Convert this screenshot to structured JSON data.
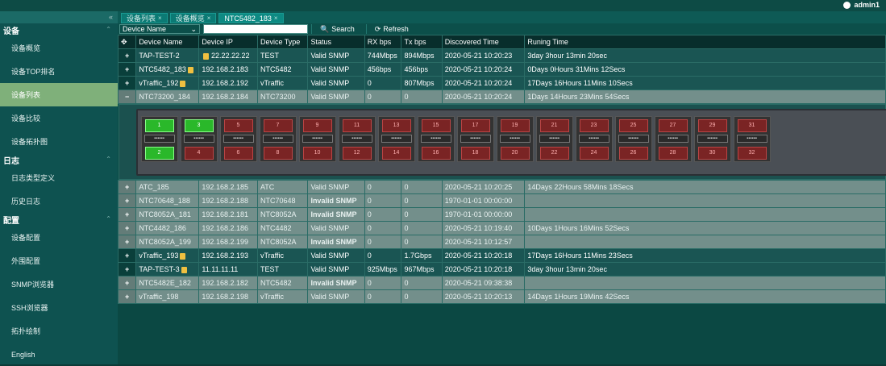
{
  "top": {
    "user": "admin1"
  },
  "sidebar": {
    "sections": [
      {
        "title": "设备",
        "items": [
          "设备概览",
          "设备TOP排名",
          "设备列表",
          "设备比较",
          "设备拓扑图"
        ]
      },
      {
        "title": "日志",
        "items": [
          "日志类型定义",
          "历史日志"
        ]
      },
      {
        "title": "配置",
        "items": [
          "设备配置",
          "外围配置",
          "SNMP浏览器",
          "SSH浏览器",
          "拓扑绘制",
          "English"
        ]
      }
    ]
  },
  "tabs": [
    "设备列表",
    "设备概览",
    "NTC5482_183"
  ],
  "toolbar": {
    "select": "Device Name",
    "search": "Search",
    "refresh": "Refresh"
  },
  "table": {
    "headers": [
      "Device Name",
      "Device IP",
      "Device Type",
      "Status",
      "RX bps",
      "Tx bps",
      "Discovered Time",
      "Runing Time"
    ],
    "rows_top": [
      {
        "name": "TAP-TEST-2",
        "ip": "22.22.22.22",
        "type": "TEST",
        "status": "Valid SNMP",
        "rx": "744Mbps",
        "tx": "894Mbps",
        "time": "2020-05-21 10:20:23",
        "run": "3day 3hour 13min 20sec"
      },
      {
        "name": "NTC5482_183",
        "ip": "192.168.2.183",
        "type": "NTC5482",
        "status": "Valid SNMP",
        "rx": "456bps",
        "tx": "456bps",
        "time": "2020-05-21 10:20:24",
        "run": "0Days 0Hours 31Mins 12Secs"
      },
      {
        "name": "vTraffic_192",
        "ip": "192.168.2.192",
        "type": "vTraffic",
        "status": "Valid SNMP",
        "rx": "0",
        "tx": "807Mbps",
        "time": "2020-05-21 10:20:24",
        "run": "17Days 16Hours 11Mins 10Secs"
      },
      {
        "name": "NTC73200_184",
        "ip": "192.168.2.184",
        "type": "NTC73200",
        "status": "Valid SNMP",
        "rx": "0",
        "tx": "0",
        "time": "2020-05-21 10:20:24",
        "run": "1Days 14Hours 23Mins 54Secs"
      }
    ],
    "rows_bottom": [
      {
        "name": "ATC_185",
        "ip": "192.168.2.185",
        "type": "ATC",
        "status": "Valid SNMP",
        "rx": "0",
        "tx": "0",
        "time": "2020-05-21 10:20:25",
        "run": "14Days 22Hours 58Mins 18Secs"
      },
      {
        "name": "NTC70648_188",
        "ip": "192.168.2.188",
        "type": "NTC70648",
        "status": "Invalid SNMP",
        "rx": "0",
        "tx": "0",
        "time": "1970-01-01 00:00:00",
        "run": ""
      },
      {
        "name": "NTC8052A_181",
        "ip": "192.168.2.181",
        "type": "NTC8052A",
        "status": "Invalid SNMP",
        "rx": "0",
        "tx": "0",
        "time": "1970-01-01 00:00:00",
        "run": ""
      },
      {
        "name": "NTC4482_186",
        "ip": "192.168.2.186",
        "type": "NTC4482",
        "status": "Valid SNMP",
        "rx": "0",
        "tx": "0",
        "time": "2020-05-21 10:19:40",
        "run": "10Days 1Hours 16Mins 52Secs"
      },
      {
        "name": "NTC8052A_199",
        "ip": "192.168.2.199",
        "type": "NTC8052A",
        "status": "Invalid SNMP",
        "rx": "0",
        "tx": "0",
        "time": "2020-05-21 10:12:57",
        "run": ""
      },
      {
        "name": "vTraffic_193",
        "ip": "192.168.2.193",
        "type": "vTraffic",
        "status": "Valid SNMP",
        "rx": "0",
        "tx": "1.7Gbps",
        "time": "2020-05-21 10:20:18",
        "run": "17Days 16Hours 11Mins 23Secs"
      },
      {
        "name": "TAP-TEST-3",
        "ip": "11.11.11.11",
        "type": "TEST",
        "status": "Valid SNMP",
        "rx": "925Mbps",
        "tx": "967Mbps",
        "time": "2020-05-21 10:20:18",
        "run": "3day 3hour 13min 20sec"
      },
      {
        "name": "NTC5482E_182",
        "ip": "192.168.2.182",
        "type": "NTC5482",
        "status": "Invalid SNMP",
        "rx": "0",
        "tx": "0",
        "time": "2020-05-21 09:38:38",
        "run": ""
      },
      {
        "name": "vTraffic_198",
        "ip": "192.168.2.198",
        "type": "vTraffic",
        "status": "Valid SNMP",
        "rx": "0",
        "tx": "0",
        "time": "2020-05-21 10:20:13",
        "run": "14Days 1Hours 19Mins 42Secs"
      }
    ]
  },
  "ports": {
    "top": [
      "1",
      "3",
      "5",
      "7",
      "9",
      "11",
      "13",
      "15",
      "17",
      "19",
      "21",
      "23",
      "25",
      "27",
      "29",
      "31"
    ],
    "bottom": [
      "2",
      "4",
      "6",
      "8",
      "10",
      "12",
      "14",
      "16",
      "18",
      "20",
      "22",
      "24",
      "26",
      "28",
      "30",
      "32"
    ],
    "up": [
      "1",
      "2",
      "3"
    ]
  }
}
